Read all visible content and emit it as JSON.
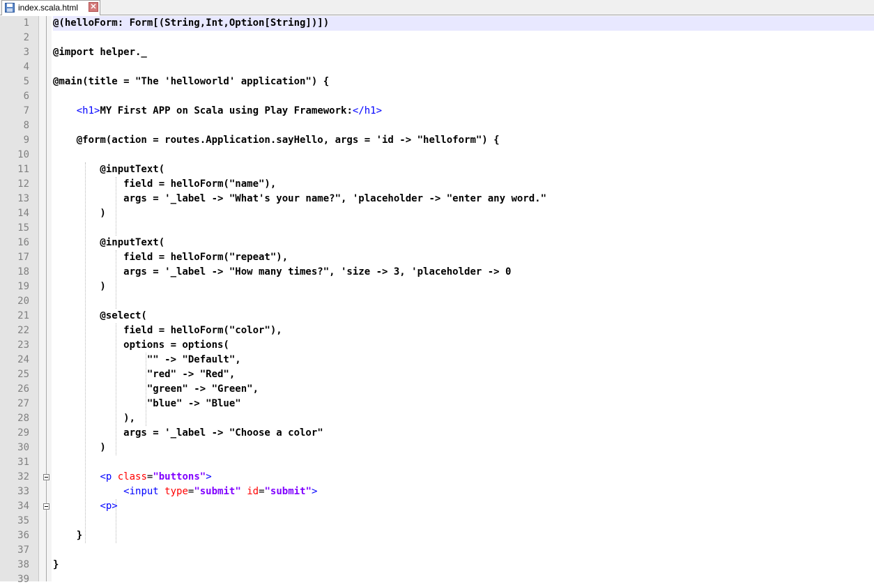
{
  "tab": {
    "filename": "index.scala.html",
    "file_icon": "save-disk-icon",
    "close_icon": "close-x-icon",
    "close_glyph": "✕"
  },
  "fold_icon": "fold-minus-icon",
  "lines": [
    {
      "num": "1",
      "text": "@(helloForm: Form[(String,Int,Option[String])])"
    },
    {
      "num": "2",
      "text": ""
    },
    {
      "num": "3",
      "text": "@import helper._"
    },
    {
      "num": "4",
      "text": ""
    },
    {
      "num": "5",
      "text": "@main(title = \"The 'helloworld' application\") {"
    },
    {
      "num": "6",
      "text": ""
    },
    {
      "num": "7",
      "text": "    <h1>MY First APP on Scala using Play Framework:</h1>"
    },
    {
      "num": "8",
      "text": ""
    },
    {
      "num": "9",
      "text": "    @form(action = routes.Application.sayHello, args = 'id -> \"helloform\") {"
    },
    {
      "num": "10",
      "text": ""
    },
    {
      "num": "11",
      "text": "        @inputText("
    },
    {
      "num": "12",
      "text": "            field = helloForm(\"name\"),"
    },
    {
      "num": "13",
      "text": "            args = '_label -> \"What's your name?\", 'placeholder -> \"enter any word.\""
    },
    {
      "num": "14",
      "text": "        )"
    },
    {
      "num": "15",
      "text": ""
    },
    {
      "num": "16",
      "text": "        @inputText("
    },
    {
      "num": "17",
      "text": "            field = helloForm(\"repeat\"),"
    },
    {
      "num": "18",
      "text": "            args = '_label -> \"How many times?\", 'size -> 3, 'placeholder -> 0"
    },
    {
      "num": "19",
      "text": "        )"
    },
    {
      "num": "20",
      "text": ""
    },
    {
      "num": "21",
      "text": "        @select("
    },
    {
      "num": "22",
      "text": "            field = helloForm(\"color\"),"
    },
    {
      "num": "23",
      "text": "            options = options("
    },
    {
      "num": "24",
      "text": "                \"\" -> \"Default\","
    },
    {
      "num": "25",
      "text": "                \"red\" -> \"Red\","
    },
    {
      "num": "26",
      "text": "                \"green\" -> \"Green\","
    },
    {
      "num": "27",
      "text": "                \"blue\" -> \"Blue\""
    },
    {
      "num": "28",
      "text": "            ),"
    },
    {
      "num": "29",
      "text": "            args = '_label -> \"Choose a color\""
    },
    {
      "num": "30",
      "text": "        )"
    },
    {
      "num": "31",
      "text": ""
    },
    {
      "num": "32",
      "text": "        <p class=\"buttons\">"
    },
    {
      "num": "33",
      "text": "            <input type=\"submit\" id=\"submit\">"
    },
    {
      "num": "34",
      "text": "        <p>"
    },
    {
      "num": "35",
      "text": ""
    },
    {
      "num": "36",
      "text": "    }"
    },
    {
      "num": "37",
      "text": ""
    },
    {
      "num": "38",
      "text": "}"
    },
    {
      "num": "39",
      "text": ""
    }
  ],
  "current_line": 1,
  "colors": {
    "current_line_bg": "#e8e8ff",
    "html_tag": "#0000ff",
    "html_attr": "#ff0000",
    "html_attr_value": "#8000ff",
    "gutter_bg": "#e4e4e4",
    "line_number": "#808080"
  }
}
